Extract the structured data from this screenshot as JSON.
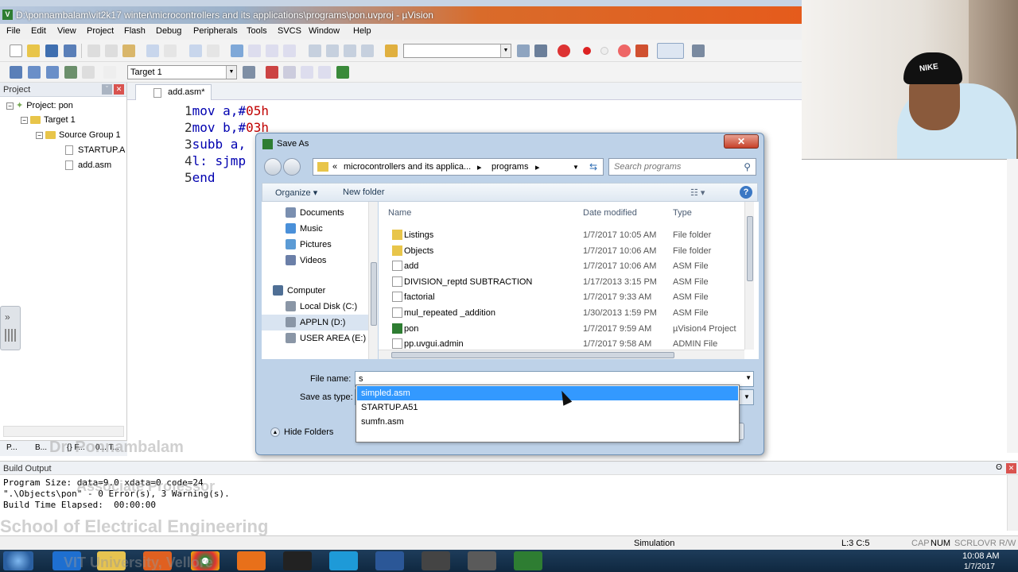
{
  "window": {
    "title": "D:\\ponnambalam\\vit2k17 winter\\microcontrollers and its applications\\programs\\pon.uvproj - µVision",
    "app_icon": "uv-app-icon"
  },
  "menu": [
    "File",
    "Edit",
    "View",
    "Project",
    "Flash",
    "Debug",
    "Peripherals",
    "Tools",
    "SVCS",
    "Window",
    "Help"
  ],
  "toolbar": {
    "target": "Target 1"
  },
  "project_panel": {
    "title": "Project",
    "tree": [
      {
        "label": "Project: pon",
        "level": 0
      },
      {
        "label": "Target 1",
        "level": 1
      },
      {
        "label": "Source Group 1",
        "level": 2
      },
      {
        "label": "STARTUP.A",
        "level": 3
      },
      {
        "label": "add.asm",
        "level": 3
      }
    ],
    "tabs": [
      "P...",
      "B...",
      "{} F...",
      "0... T..."
    ]
  },
  "editor": {
    "tab": "add.asm*",
    "lines": [
      {
        "n": "1",
        "pre": "mov a,#",
        "num": "05h",
        "post": ""
      },
      {
        "n": "2",
        "pre": "mov b,#",
        "num": "03h",
        "post": ""
      },
      {
        "n": "3",
        "pre": "subb a,",
        "num": "",
        "post": ""
      },
      {
        "n": "4",
        "pre": "l: sjmp",
        "num": "",
        "post": ""
      },
      {
        "n": "5",
        "pre": "end",
        "num": "",
        "post": ""
      }
    ]
  },
  "build_output": {
    "title": "Build Output",
    "lines": [
      "Program Size: data=9.0 xdata=0 code=24",
      "\".\\Objects\\pon\" - 0 Error(s), 3 Warning(s).",
      "Build Time Elapsed:  00:00:00"
    ]
  },
  "watermark": {
    "name": "Dr. Ponnambalam",
    "role": "Associate Professor",
    "school": "School of Electrical Engineering",
    "university": "VIT University, Vellore"
  },
  "statusbar": {
    "mode": "Simulation",
    "position": "L:3 C:5",
    "caps": "CAP",
    "num": "NUM",
    "scrl": "SCRL",
    "ovr": "OVR",
    "rw": "R/W"
  },
  "taskbar": {
    "time": "10:08 AM",
    "date": "1/7/2017"
  },
  "dialog": {
    "title": "Save As",
    "path": [
      "microcontrollers and its applica...",
      "programs"
    ],
    "search_placeholder": "Search programs",
    "organize": "Organize ▾",
    "new_folder": "New folder",
    "nav_items": [
      {
        "label": "Documents",
        "indent": 1,
        "color": "#7a8fb0"
      },
      {
        "label": "Music",
        "indent": 1,
        "color": "#4a90d9"
      },
      {
        "label": "Pictures",
        "indent": 1,
        "color": "#5b9bd5"
      },
      {
        "label": "Videos",
        "indent": 1,
        "color": "#6b7fa8"
      },
      {
        "label": "Computer",
        "indent": 0,
        "color": "#4f6f95"
      },
      {
        "label": "Local Disk (C:)",
        "indent": 1,
        "color": "#8a96a6"
      },
      {
        "label": "APPLN (D:)",
        "indent": 1,
        "color": "#8a96a6",
        "selected": true
      },
      {
        "label": "USER AREA (E:)",
        "indent": 1,
        "color": "#8a96a6"
      }
    ],
    "columns": {
      "name": "Name",
      "date": "Date modified",
      "type": "Type"
    },
    "files": [
      {
        "name": "Listings",
        "date": "1/7/2017 10:05 AM",
        "type": "File folder",
        "icon": "folder"
      },
      {
        "name": "Objects",
        "date": "1/7/2017 10:06 AM",
        "type": "File folder",
        "icon": "folder"
      },
      {
        "name": "add",
        "date": "1/7/2017 10:06 AM",
        "type": "ASM File",
        "icon": "file"
      },
      {
        "name": "DIVISION_reptd SUBTRACTION",
        "date": "1/17/2013 3:15 PM",
        "type": "ASM File",
        "icon": "file"
      },
      {
        "name": "factorial",
        "date": "1/7/2017 9:33 AM",
        "type": "ASM File",
        "icon": "file"
      },
      {
        "name": "mul_repeated _addition",
        "date": "1/30/2013 1:59 PM",
        "type": "ASM File",
        "icon": "file"
      },
      {
        "name": "pon",
        "date": "1/7/2017 9:59 AM",
        "type": "µVision4 Project",
        "icon": "project"
      },
      {
        "name": "pp.uvgui.admin",
        "date": "1/7/2017 9:58 AM",
        "type": "ADMIN File",
        "icon": "file"
      }
    ],
    "file_name_label": "File name:",
    "file_name_value": "s",
    "save_as_type_label": "Save as type:",
    "hide_folders": "Hide Folders",
    "autocomplete": [
      "simpled.asm",
      "STARTUP.A51",
      "sumfn.asm"
    ]
  }
}
